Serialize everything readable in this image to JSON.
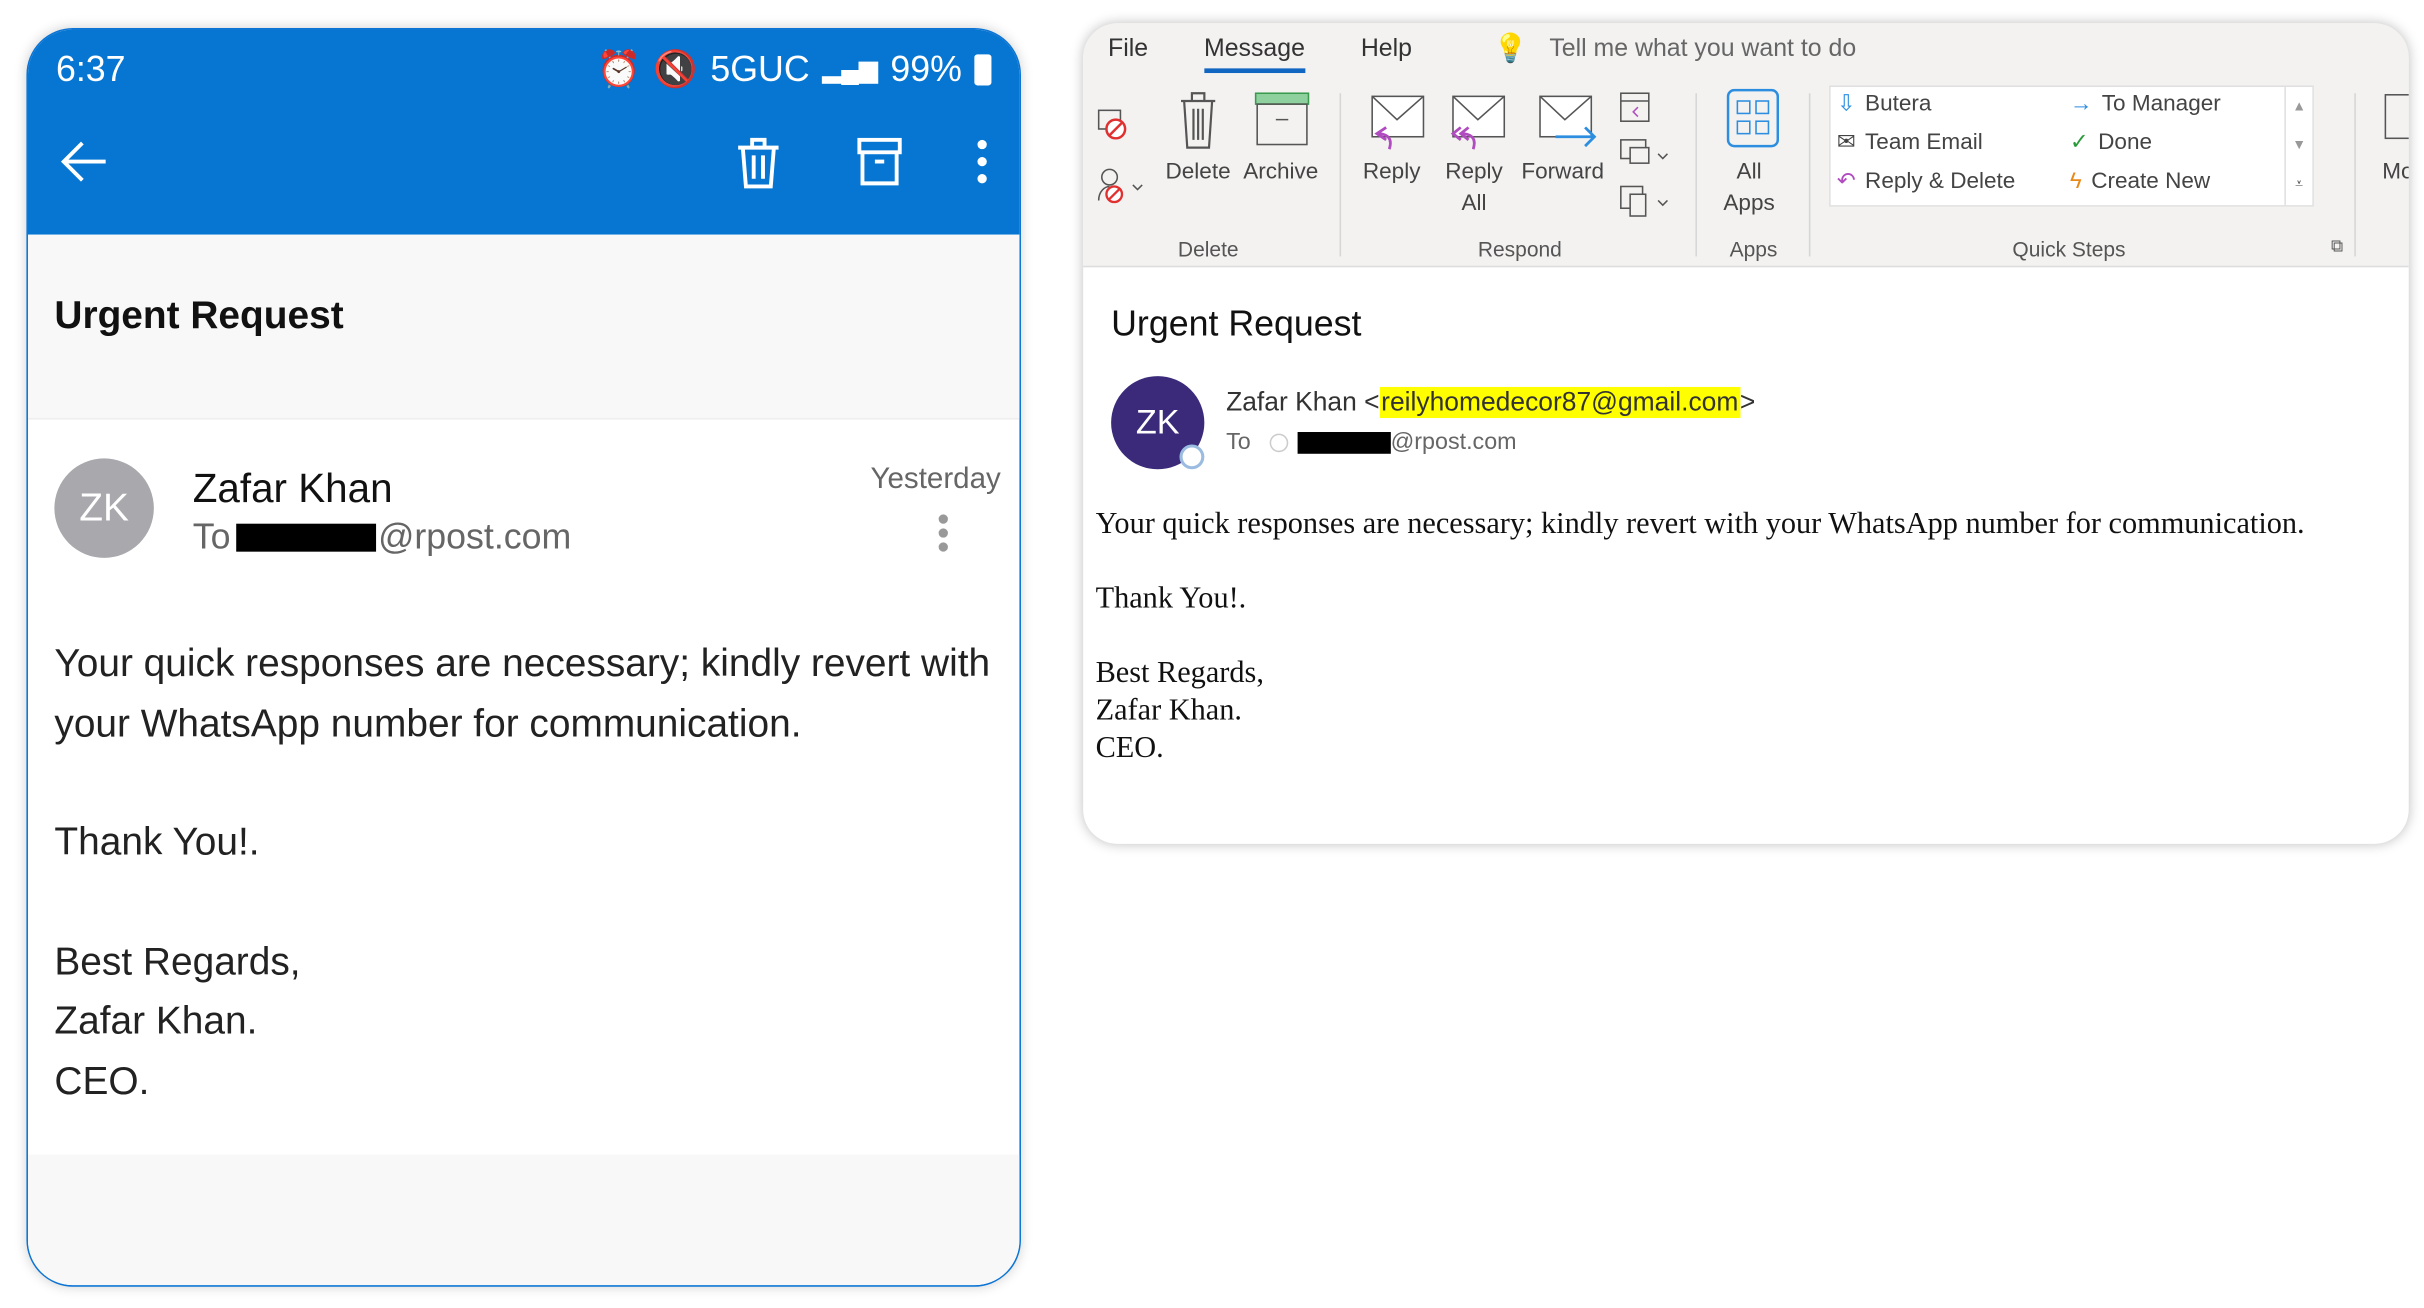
{
  "mobile": {
    "status": {
      "time": "6:37",
      "network": "5GUC",
      "battery": "99%"
    },
    "subject": "Urgent Request",
    "sender_initials": "ZK",
    "sender_name": "Zafar Khan",
    "to_label": "To",
    "to_domain": "@rpost.com",
    "date": "Yesterday",
    "body": [
      "Your quick responses are necessary; kindly revert with your WhatsApp number for communication.",
      "Thank You!.",
      "Best Regards,",
      "Zafar Khan.",
      "CEO."
    ],
    "accent": "#0676d2"
  },
  "desktop": {
    "menu": [
      "File",
      "Message",
      "Help"
    ],
    "tell_me": "Tell me what you want to do",
    "ribbon": {
      "delete": "Delete",
      "archive": "Archive",
      "reply": "Reply",
      "reply_all_1": "Reply",
      "reply_all_2": "All",
      "forward": "Forward",
      "all_apps_1": "All",
      "all_apps_2": "Apps",
      "more": "Mo",
      "groups": [
        "Delete",
        "Respond",
        "Apps",
        "Quick Steps"
      ],
      "quick_steps": [
        "Butera",
        "To Manager",
        "Team Email",
        "Done",
        "Reply & Delete",
        "Create New"
      ]
    },
    "subject": "Urgent Request",
    "sender_initials": "ZK",
    "sender_name": "Zafar Khan",
    "sender_email_open": "<",
    "sender_email": "reilyhomedecor87@gmail.com",
    "sender_email_close": ">",
    "to_label": "To",
    "to_domain": "@rpost.com",
    "body": [
      "Your quick responses are necessary; kindly revert with your WhatsApp number for communication.",
      "Thank You!.",
      "Best Regards,",
      "Zafar Khan.",
      "CEO."
    ],
    "highlight": "#ffff00",
    "avatar_color": "#3b2a7a"
  }
}
